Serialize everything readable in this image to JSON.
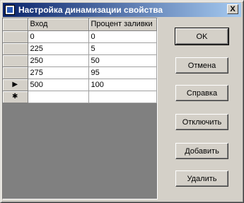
{
  "window": {
    "title": "Настройка динамизации свойства",
    "close_glyph": "X"
  },
  "grid": {
    "columns": [
      "Вход",
      "Процент заливки"
    ],
    "rows": [
      {
        "marker": "",
        "input": "0",
        "fill": "0"
      },
      {
        "marker": "",
        "input": "225",
        "fill": "5"
      },
      {
        "marker": "",
        "input": "250",
        "fill": "50"
      },
      {
        "marker": "",
        "input": "275",
        "fill": "95"
      },
      {
        "marker": "▶",
        "input": "500",
        "fill": "100"
      },
      {
        "marker": "✱",
        "input": "",
        "fill": ""
      }
    ]
  },
  "buttons": {
    "ok": "OK",
    "cancel": "Отмена",
    "help": "Справка",
    "disable": "Отключить",
    "add": "Добавить",
    "delete": "Удалить"
  }
}
